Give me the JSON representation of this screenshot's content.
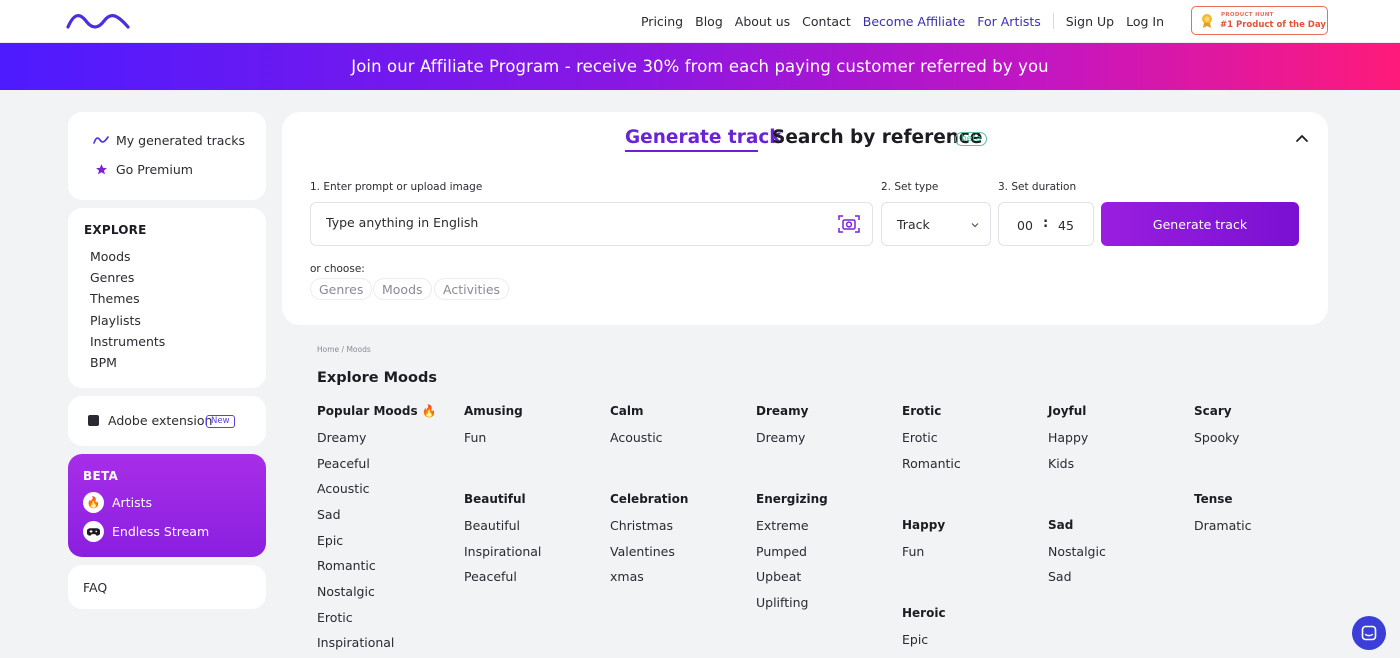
{
  "nav": {
    "links": [
      {
        "label": "Pricing",
        "accent": false
      },
      {
        "label": "Blog",
        "accent": false
      },
      {
        "label": "About us",
        "accent": false
      },
      {
        "label": "Contact",
        "accent": false
      },
      {
        "label": "Become Affiliate",
        "accent": true
      },
      {
        "label": "For Artists",
        "accent": true
      }
    ],
    "auth": [
      {
        "label": "Sign Up"
      },
      {
        "label": "Log In"
      }
    ],
    "badge": {
      "small": "PRODUCT HUNT",
      "big": "#1 Product of the Day"
    }
  },
  "banner": {
    "text": "Join our Affiliate Program - receive 30% from each paying customer referred by you"
  },
  "sidebar": {
    "top": [
      {
        "label": "My generated tracks",
        "icon": "wave-icon"
      },
      {
        "label": "Go Premium",
        "icon": "star-icon"
      }
    ],
    "explore_heading": "EXPLORE",
    "explore": [
      "Moods",
      "Genres",
      "Themes",
      "Playlists",
      "Instruments",
      "BPM"
    ],
    "extension": {
      "label": "Adobe extension",
      "badge": "New"
    },
    "beta_heading": "BETA",
    "beta": [
      {
        "label": "Artists",
        "icon": "fire-icon"
      },
      {
        "label": "Endless Stream",
        "icon": "gamepad-icon"
      }
    ],
    "faq": "FAQ"
  },
  "generator": {
    "tab_generate": "Generate track",
    "tab_search": "Search by reference",
    "beta_badge": "beta",
    "label_prompt": "1. Enter prompt or upload image",
    "label_type": "2. Set type",
    "label_duration": "3. Set duration",
    "prompt_placeholder": "Type anything in English",
    "type_value": "Track",
    "duration_min": "00",
    "duration_sec": "45",
    "colon": ":",
    "button": "Generate track",
    "or_choose": "or choose:",
    "chips": [
      "Genres",
      "Moods",
      "Activities"
    ]
  },
  "explore": {
    "breadcrumb": "Home  /  Moods",
    "title": "Explore Moods",
    "popular_heading": "Popular Moods 🔥",
    "popular": [
      "Dreamy",
      "Peaceful",
      "Acoustic",
      "Sad",
      "Epic",
      "Romantic",
      "Nostalgic",
      "Erotic",
      "Inspirational"
    ],
    "groups": [
      {
        "heading": "Amusing",
        "items": [
          "Fun"
        ]
      },
      {
        "heading": "Beautiful",
        "items": [
          "Beautiful",
          "Inspirational",
          "Peaceful"
        ]
      },
      {
        "heading": "Calm",
        "items": [
          "Acoustic"
        ]
      },
      {
        "heading": "Celebration",
        "items": [
          "Christmas",
          "Valentines",
          "xmas"
        ]
      },
      {
        "heading": "Dreamy",
        "items": [
          "Dreamy"
        ]
      },
      {
        "heading": "Energizing",
        "items": [
          "Extreme",
          "Pumped",
          "Upbeat",
          "Uplifting"
        ]
      },
      {
        "heading": "Erotic",
        "items": [
          "Erotic",
          "Romantic"
        ]
      },
      {
        "heading": "Happy",
        "items": [
          "Fun"
        ]
      },
      {
        "heading": "Heroic",
        "items": [
          "Epic"
        ]
      },
      {
        "heading": "Joyful",
        "items": [
          "Happy",
          "Kids"
        ]
      },
      {
        "heading": "Sad",
        "items": [
          "Nostalgic",
          "Sad"
        ]
      },
      {
        "heading": "Scary",
        "items": [
          "Spooky"
        ]
      },
      {
        "heading": "Tense",
        "items": [
          "Dramatic"
        ]
      }
    ]
  }
}
